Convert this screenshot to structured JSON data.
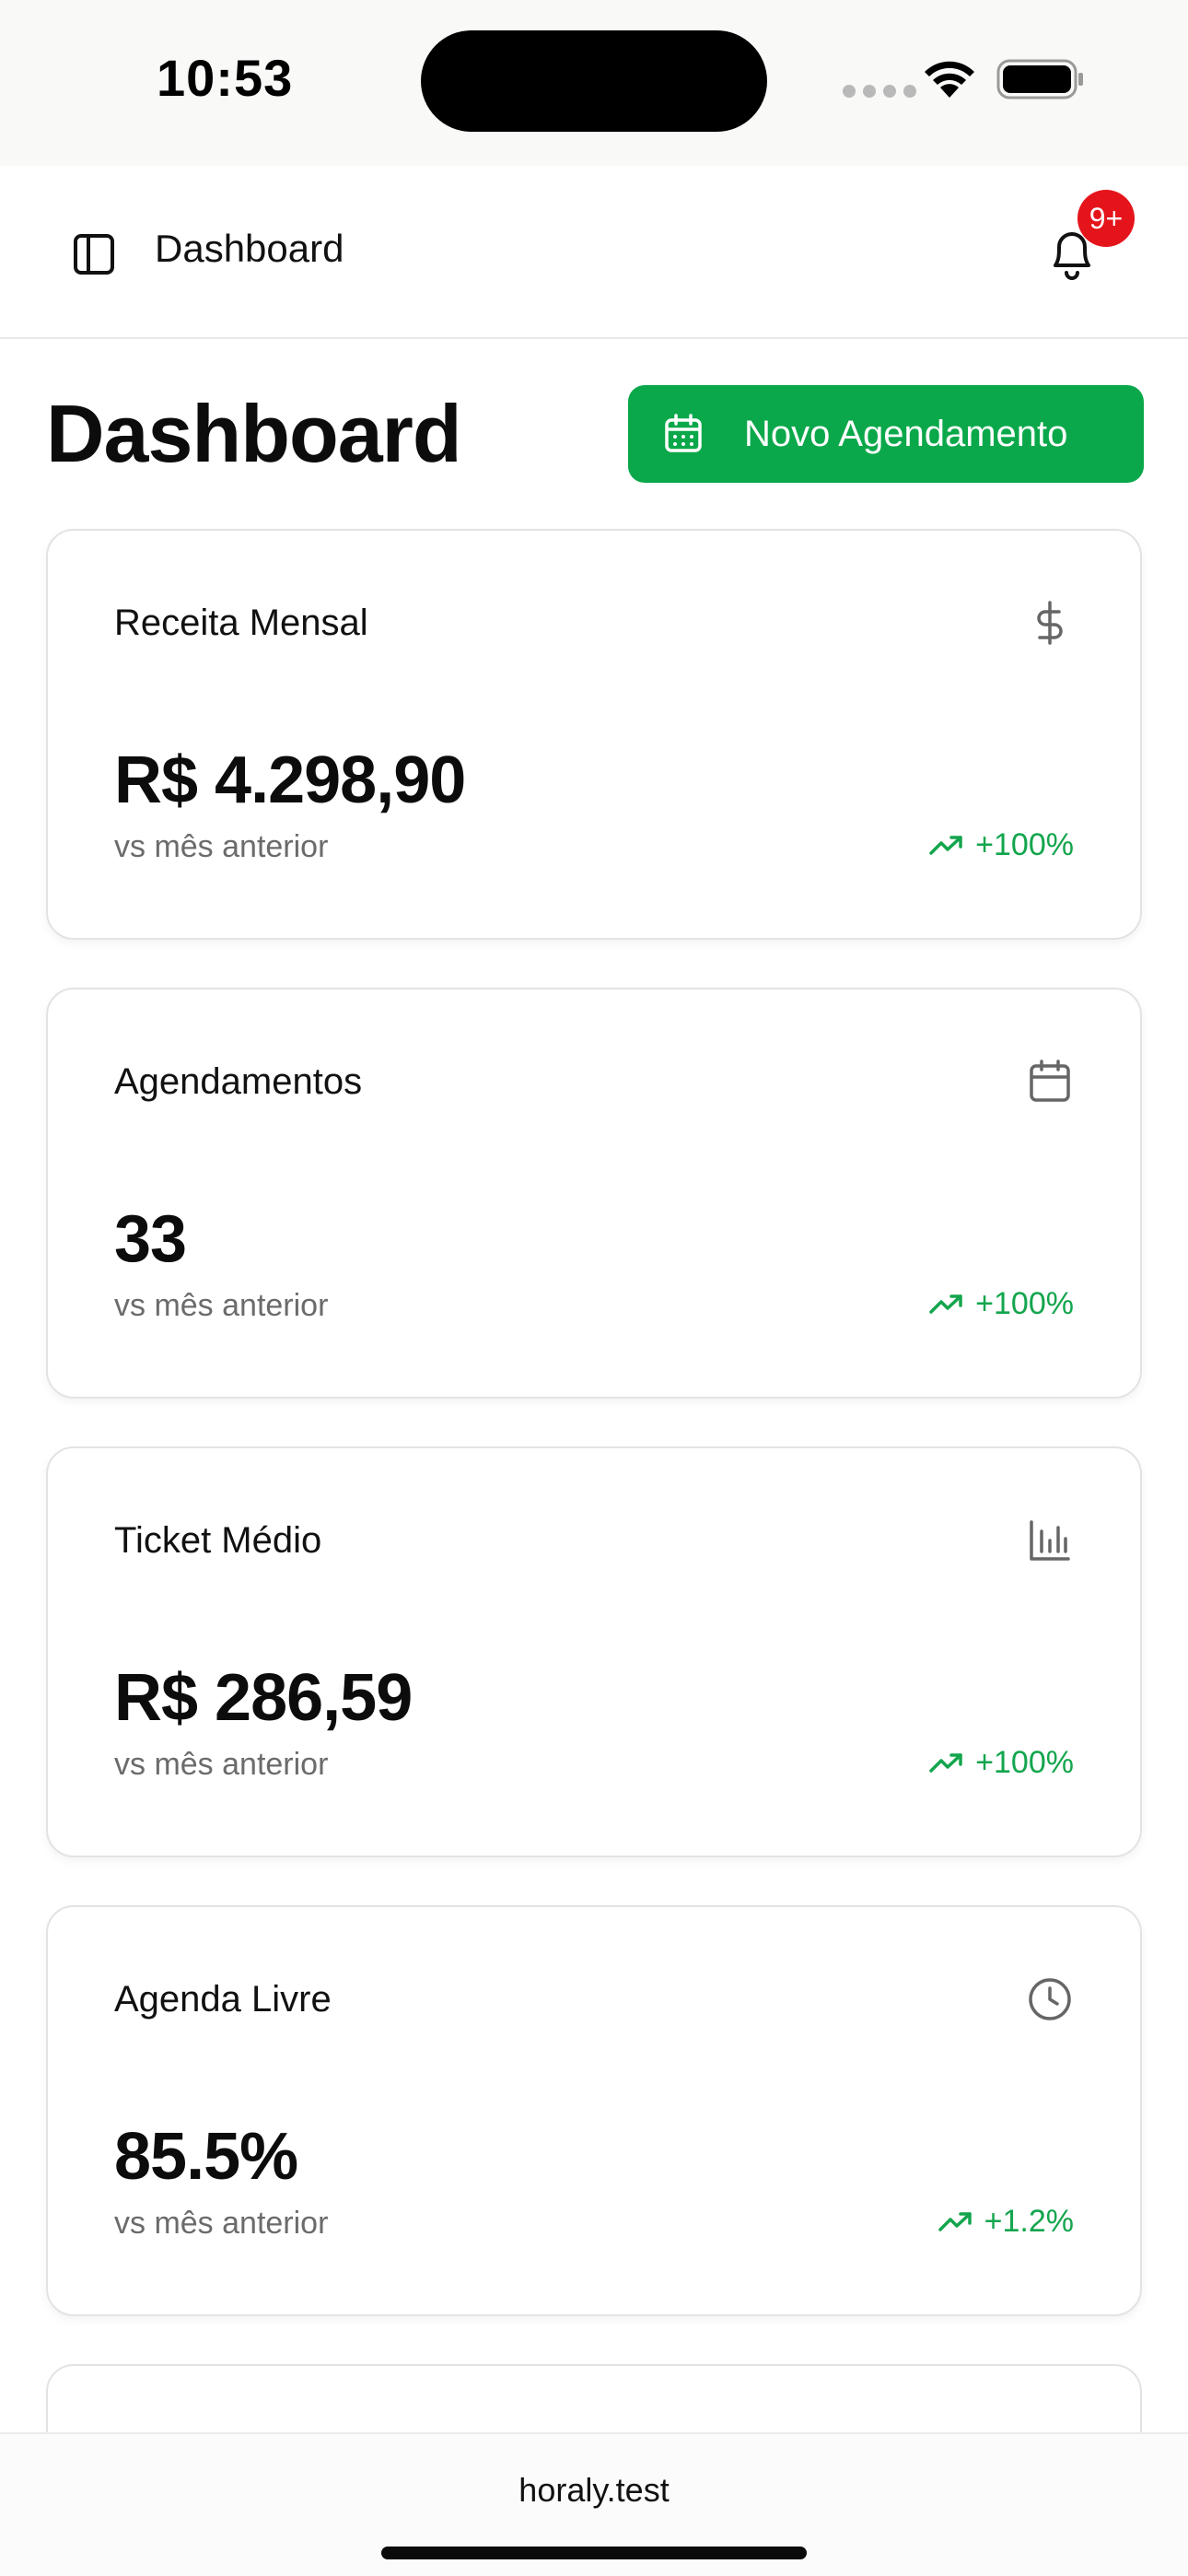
{
  "status_bar": {
    "time": "10:53"
  },
  "top_bar": {
    "title": "Dashboard",
    "notification_badge": "9+"
  },
  "page": {
    "title": "Dashboard",
    "new_button_label": "Novo Agendamento"
  },
  "cards": [
    {
      "title": "Receita Mensal",
      "icon": "dollar-icon",
      "value": "R$ 4.298,90",
      "subtitle": "vs mês anterior",
      "trend": "+100%"
    },
    {
      "title": "Agendamentos",
      "icon": "calendar-icon",
      "value": "33",
      "subtitle": "vs mês anterior",
      "trend": "+100%"
    },
    {
      "title": "Ticket Médio",
      "icon": "bar-chart-icon",
      "value": "R$ 286,59",
      "subtitle": "vs mês anterior",
      "trend": "+100%"
    },
    {
      "title": "Agenda Livre",
      "icon": "clock-icon",
      "value": "85.5%",
      "subtitle": "vs mês anterior",
      "trend": "+1.2%"
    }
  ],
  "browser": {
    "url": "horaly.test"
  },
  "colors": {
    "accent_green": "#0aa84a",
    "trend_green": "#13a54d",
    "badge_red": "#e5141b"
  }
}
